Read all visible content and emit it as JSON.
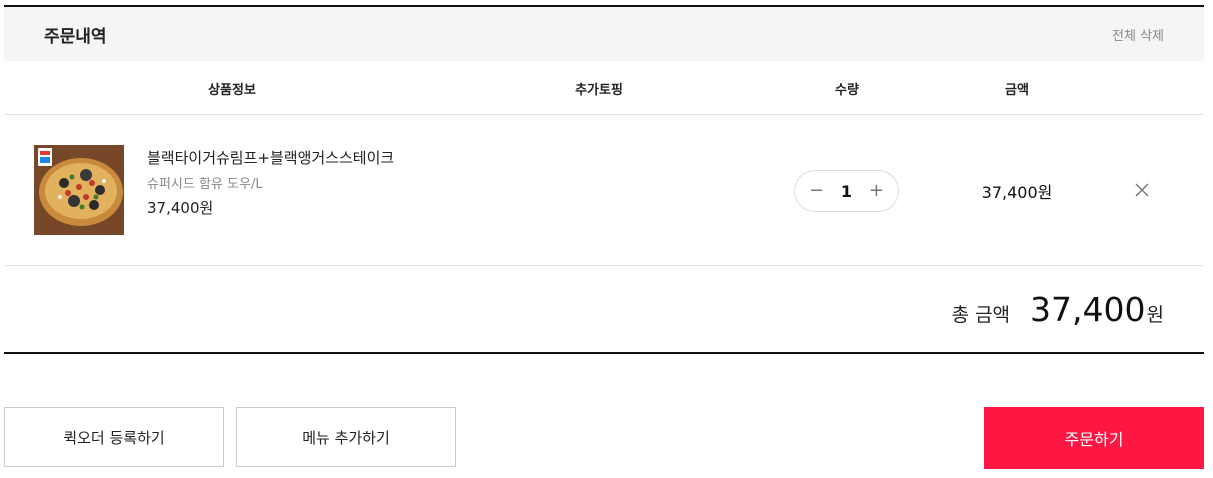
{
  "header": {
    "title": "주문내역",
    "delete_all": "전체 삭제"
  },
  "columns": {
    "product": "상품정보",
    "topping": "추가토핑",
    "quantity": "수량",
    "amount": "금액"
  },
  "item": {
    "name": "블랙타이거슈림프+블랙앵거스스테이크",
    "option": "슈퍼시드 함유 도우/L",
    "price": "37,400원",
    "quantity": "1",
    "amount": "37,400원",
    "minus_symbol": "−",
    "plus_symbol": "+",
    "thumbnail_icon": "pizza-image",
    "remove_icon": "close-icon"
  },
  "total": {
    "label": "총 금액",
    "value": "37,400",
    "unit": "원"
  },
  "buttons": {
    "quick_order": "퀵오더 등록하기",
    "add_menu": "메뉴 추가하기",
    "order": "주문하기"
  },
  "colors": {
    "accent": "#ff1744",
    "header_bg": "#f5f5f5"
  }
}
